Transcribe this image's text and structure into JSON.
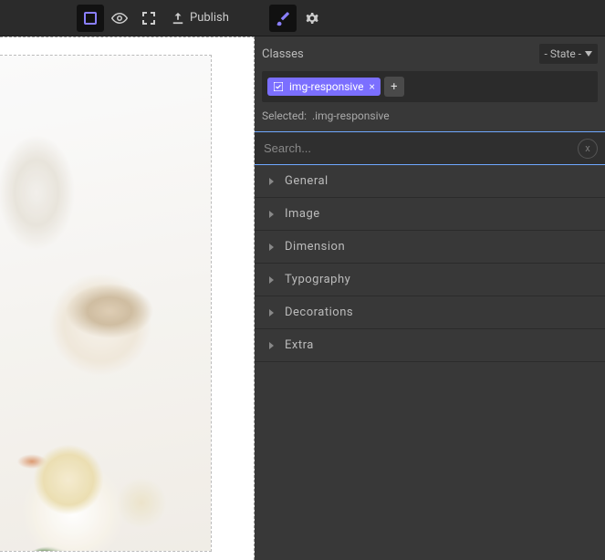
{
  "topbar": {
    "publish_label": "Publish"
  },
  "panel": {
    "classes_label": "Classes",
    "state_label": "- State -",
    "chip_label": "img-responsive",
    "add_label": "+",
    "selected_label": "Selected:",
    "selected_value": ".img-responsive",
    "search_placeholder": "Search...",
    "clear_label": "x",
    "sections": [
      {
        "label": "General"
      },
      {
        "label": "Image"
      },
      {
        "label": "Dimension"
      },
      {
        "label": "Typography"
      },
      {
        "label": "Decorations"
      },
      {
        "label": "Extra"
      }
    ]
  }
}
